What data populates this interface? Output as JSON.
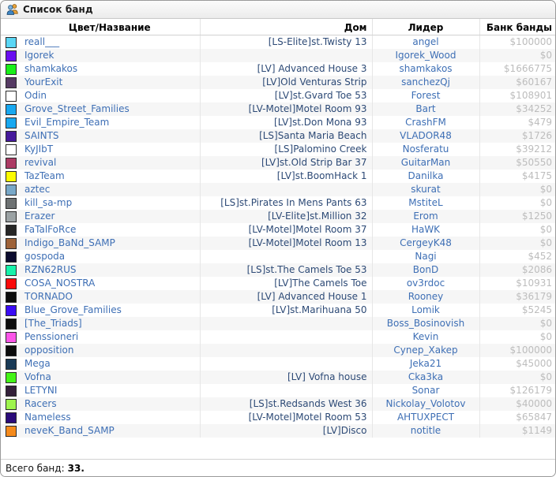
{
  "window": {
    "title": "Список банд",
    "icon": "users-icon"
  },
  "table": {
    "headers": {
      "color_name": "Цвет/Название",
      "house": "Дом",
      "leader": "Лидер",
      "bank": "Банк банды"
    },
    "rows": [
      {
        "color": "#5ad6f5",
        "name": "reall___",
        "house": "[LS-Elite]st.Twisty 13",
        "leader": "angel",
        "bank": "$100000"
      },
      {
        "color": "#6a0ef0",
        "name": "Igorek",
        "house": "",
        "leader": "Igorek_Wood",
        "bank": "$0"
      },
      {
        "color": "#19f019",
        "name": "shamkakos",
        "house": "[LV] Advanced House 3",
        "leader": "shamkakos",
        "bank": "$1666775"
      },
      {
        "color": "#553a63",
        "name": "YourExit",
        "house": "[LV]Old Venturas Strip",
        "leader": "sanchezQj",
        "bank": "$60167"
      },
      {
        "color": "#ffffff",
        "name": "Odin",
        "house": "[LV]st.Gvard Toe 53",
        "leader": "Forest",
        "bank": "$108901"
      },
      {
        "color": "#18a8f0",
        "name": "Grove_Street_Families",
        "house": "[LV-Motel]Motel Room 93",
        "leader": "Bart",
        "bank": "$34252"
      },
      {
        "color": "#18a8f0",
        "name": "Evil_Empire_Team",
        "house": "[LV]st.Don Mona 93",
        "leader": "CrashFM",
        "bank": "$479"
      },
      {
        "color": "#45199b",
        "name": "SAINTS",
        "house": "[LS]Santa Maria Beach",
        "leader": "VLADOR48",
        "bank": "$1726"
      },
      {
        "color": "#ffffff",
        "name": "KyJIbT",
        "house": "[LS]Palomino Creek",
        "leader": "Nosferatu",
        "bank": "$39212"
      },
      {
        "color": "#ac3a63",
        "name": "revival",
        "house": "[LV]st.Old Strip Bar 37",
        "leader": "GuitarMan",
        "bank": "$50550"
      },
      {
        "color": "#fcfc00",
        "name": "TazTeam",
        "house": "[LV]st.BoomHack 1",
        "leader": "Danilka",
        "bank": "$4175"
      },
      {
        "color": "#78a8c8",
        "name": "aztec",
        "house": "",
        "leader": "skurat",
        "bank": "$0"
      },
      {
        "color": "#6e7273",
        "name": "kill_sa-mp",
        "house": "[LS]st.Pirates In Mens Pants 63",
        "leader": "MstiteL",
        "bank": "$0"
      },
      {
        "color": "#9ba2a4",
        "name": "Erazer",
        "house": "[LV-Elite]st.Million 32",
        "leader": "Erom",
        "bank": "$1250"
      },
      {
        "color": "#262626",
        "name": "FaTalFoRce",
        "house": "[LV-Motel]Motel Room 37",
        "leader": "HaWK",
        "bank": "$0"
      },
      {
        "color": "#9e6238",
        "name": "Indigo_BaNd_SAMP",
        "house": "[LV-Motel]Motel Room 13",
        "leader": "CergeyK48",
        "bank": "$0"
      },
      {
        "color": "#0b0b2e",
        "name": "gospoda",
        "house": "",
        "leader": "Nagi",
        "bank": "$452"
      },
      {
        "color": "#17f2ab",
        "name": "RZN62RUS",
        "house": "[LS]st.The Camels Toe 53",
        "leader": "BonD",
        "bank": "$2086"
      },
      {
        "color": "#fb0b0b",
        "name": "COSA_NOSTRA",
        "house": "[LV]The Camels Toe",
        "leader": "ov3rdoc",
        "bank": "$10931"
      },
      {
        "color": "#0c0c0c",
        "name": "TORNADO",
        "house": "[LV] Advanced House 1",
        "leader": "Rooney",
        "bank": "$36179"
      },
      {
        "color": "#3a0bf5",
        "name": "Blue_Grove_Families",
        "house": "[LV]st.Marihuana 50",
        "leader": "Lomik",
        "bank": "$5245"
      },
      {
        "color": "#0c0c0c",
        "name": "[The_Triads]",
        "house": "",
        "leader": "Boss_Bosinovish",
        "bank": "$0"
      },
      {
        "color": "#fc55e8",
        "name": "Penssioneri",
        "house": "",
        "leader": "Kevin",
        "bank": "$0"
      },
      {
        "color": "#0c0c0c",
        "name": "opposition",
        "house": "",
        "leader": "Cynep_Xakep",
        "bank": "$100000"
      },
      {
        "color": "#193a56",
        "name": "Mega",
        "house": "",
        "leader": "Jeka21",
        "bank": "$45000"
      },
      {
        "color": "#44f517",
        "name": "Vofna",
        "house": "[LV] Vofna house",
        "leader": "Cka3ka",
        "bank": "$0"
      },
      {
        "color": "#34203a",
        "name": "LETYNI",
        "house": "",
        "leader": "Sonar",
        "bank": "$126179"
      },
      {
        "color": "#9ef54d",
        "name": "Racers",
        "house": "[LS]st.Redsands West 36",
        "leader": "Nickolay_Volotov",
        "bank": "$40000"
      },
      {
        "color": "#2a0b7a",
        "name": "Nameless",
        "house": "[LV-Motel]Motel Room 53",
        "leader": "AHTUXPECT",
        "bank": "$65847"
      },
      {
        "color": "#f58a1b",
        "name": "neveK_Band_SAMP",
        "house": "[LV]Disco",
        "leader": "notitle",
        "bank": "$1149"
      }
    ]
  },
  "footer": {
    "label": "Всего банд:",
    "count": "33."
  }
}
